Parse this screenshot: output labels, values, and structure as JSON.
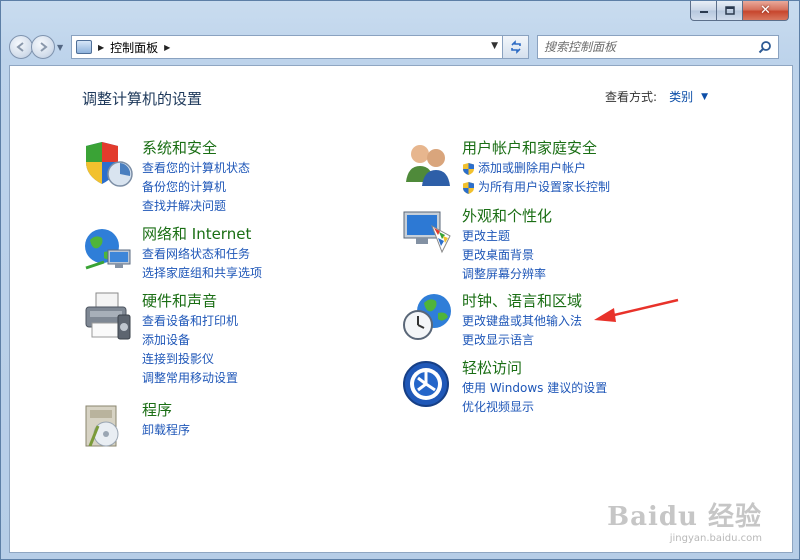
{
  "window": {
    "close_glyph": "✕"
  },
  "nav": {
    "breadcrumb": "控制面板",
    "search_placeholder": "搜索控制面板"
  },
  "header": {
    "title": "调整计算机的设置",
    "view_by_label": "查看方式:",
    "view_by_value": "类别"
  },
  "categories": [
    {
      "title": "系统和安全",
      "icon": "shield-icon",
      "links": [
        "查看您的计算机状态",
        "备份您的计算机",
        "查找并解决问题"
      ]
    },
    {
      "title": "网络和 Internet",
      "icon": "globe-network-icon",
      "links": [
        "查看网络状态和任务",
        "选择家庭组和共享选项"
      ]
    },
    {
      "title": "硬件和声音",
      "icon": "printer-icon",
      "links": [
        "查看设备和打印机",
        "添加设备",
        "连接到投影仪",
        "调整常用移动设置"
      ]
    },
    {
      "title": "程序",
      "icon": "programs-icon",
      "links": [
        "卸载程序"
      ]
    },
    {
      "title": "用户帐户和家庭安全",
      "icon": "users-icon",
      "links": [
        "添加或删除用户帐户",
        "为所有用户设置家长控制"
      ]
    },
    {
      "title": "外观和个性化",
      "icon": "monitor-palette-icon",
      "links": [
        "更改主题",
        "更改桌面背景",
        "调整屏幕分辨率"
      ]
    },
    {
      "title": "时钟、语言和区域",
      "icon": "clock-globe-icon",
      "links": [
        "更改键盘或其他输入法",
        "更改显示语言"
      ]
    },
    {
      "title": "轻松访问",
      "icon": "ease-of-access-icon",
      "links": [
        "使用 Windows 建议的设置",
        "优化视频显示"
      ]
    }
  ],
  "watermark": {
    "main": "Baidu 经验",
    "sub": "jingyan.baidu.com"
  },
  "colors": {
    "title_green": "#1a6e14",
    "link_blue": "#1f57b8",
    "annotation_red": "#e8322a"
  }
}
